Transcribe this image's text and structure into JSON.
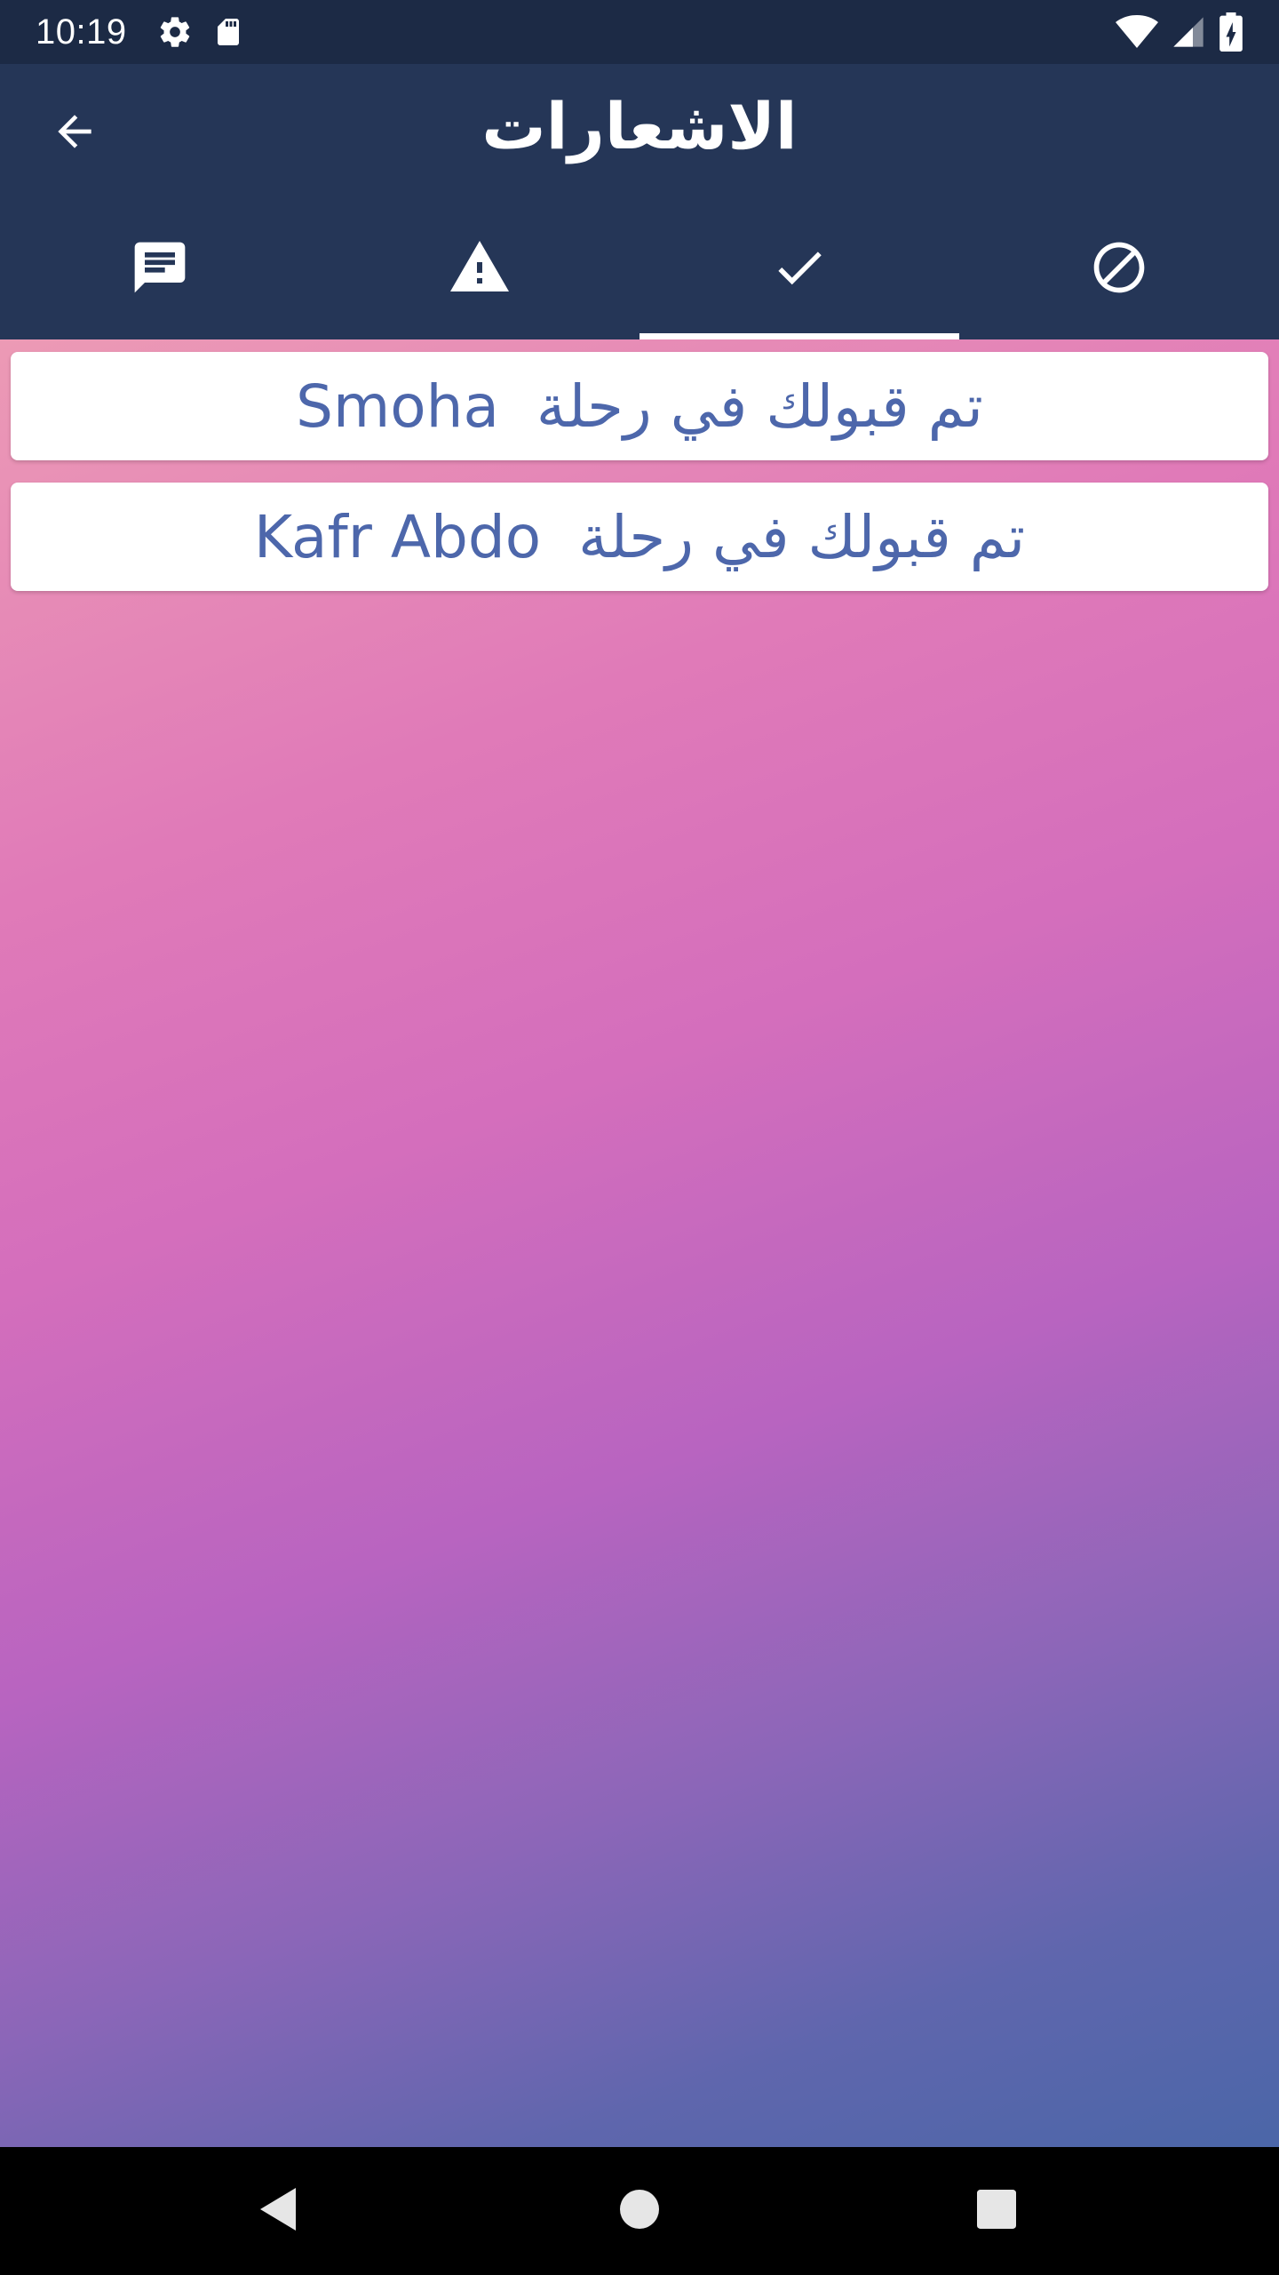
{
  "status_bar": {
    "time": "10:19",
    "icons": [
      "gear-icon",
      "sd-card-icon",
      "wifi-icon",
      "cell-signal-icon",
      "battery-charging-icon"
    ]
  },
  "app_bar": {
    "title": "الاشعارات",
    "back_icon": "arrow-back-icon"
  },
  "tabs": [
    {
      "icon": "message-icon",
      "active": false
    },
    {
      "icon": "warning-icon",
      "active": false
    },
    {
      "icon": "check-icon",
      "active": true
    },
    {
      "icon": "block-icon",
      "active": false
    }
  ],
  "notifications": [
    {
      "text": "تم قبولك في رحلة  Smoha"
    },
    {
      "text": "تم قبولك في رحلة  Kafr Abdo"
    }
  ],
  "colors": {
    "app_bar": "#253657",
    "status_bar": "#1c2a45",
    "card_text": "#4d67ab"
  },
  "nav_bar": {
    "icons": [
      "back-triangle-icon",
      "home-circle-icon",
      "recents-square-icon"
    ]
  }
}
